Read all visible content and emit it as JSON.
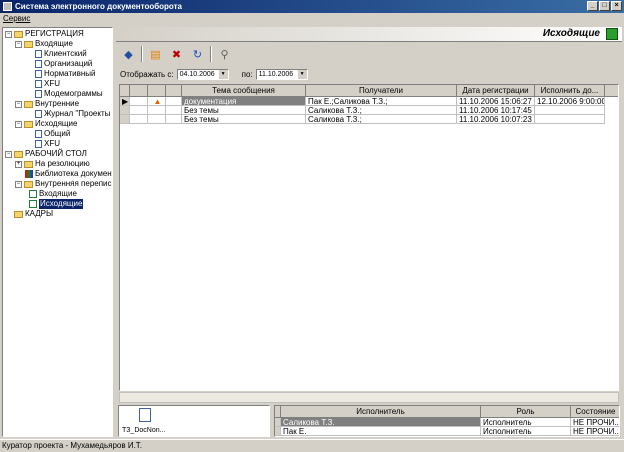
{
  "window": {
    "title": "Система электронного документооборота",
    "min": "_",
    "max": "□",
    "close": "×"
  },
  "menu": {
    "service": "Сервис"
  },
  "tree": {
    "registration": "РЕГИСТРАЦИЯ",
    "incoming": "Входящие",
    "client": "Клиентский",
    "orgs": "Организаций",
    "normative": "Нормативный",
    "xfu": "XFU",
    "modem": "Модемограммы",
    "internal": "Внутренние",
    "journal": "Журнал \"Проекты",
    "outgoing": "Исходящие",
    "general": "Общий",
    "xfu2": "XFU",
    "desk": "РАБОЧИЙ СТОЛ",
    "resolution": "На резолюцию",
    "library": "Библиотека документ",
    "internal_mail": "Внутренняя переписка",
    "mail_in": "Входящие",
    "mail_out": "Исходящие",
    "staff": "КАДРЫ"
  },
  "main": {
    "title": "Исходящие",
    "filter": {
      "from_label": "Отображать с:",
      "from_value": "04.10.2006",
      "to_label": "по:",
      "to_value": "11.10.2006"
    },
    "columns": {
      "subject": "Тема сообщения",
      "recipients": "Получатели",
      "reg_date": "Дата регистрации",
      "due": "Исполнить до..."
    },
    "rows": [
      {
        "subject": "документация",
        "recipients": "Пак Е.;Саликова Т.З.;",
        "reg_date": "11.10.2006 15:06:27",
        "due": "12.10.2006 9:00:00"
      },
      {
        "subject": "Без темы",
        "recipients": "Саликова Т.З.;",
        "reg_date": "11.10.2006 10:17:45",
        "due": ""
      },
      {
        "subject": "Без темы",
        "recipients": "Саликова Т.З.;",
        "reg_date": "11.10.2006 10:07:23",
        "due": ""
      }
    ]
  },
  "attachment": {
    "filename": "ТЗ_DocNon..."
  },
  "performers": {
    "columns": {
      "performer": "Исполнитель",
      "role": "Роль",
      "state": "Состояние"
    },
    "rows": [
      {
        "performer": "Саликова Т.З.",
        "role": "Исполнитель",
        "state": "НЕ ПРОЧИ..."
      },
      {
        "performer": "Пак Е.",
        "role": "Исполнитель",
        "state": "НЕ ПРОЧИ..."
      }
    ]
  },
  "status": {
    "text": "Куратор проекта - Мухамедьяров И.Т."
  },
  "colors": {
    "titlebar": "#0a246a",
    "selection": "#0a246a",
    "row_selected": "#808080"
  },
  "icons": [
    "diamond-icon",
    "new-doc-icon",
    "delete-icon",
    "refresh-icon",
    "search-icon",
    "warning-icon",
    "exit-icon"
  ]
}
